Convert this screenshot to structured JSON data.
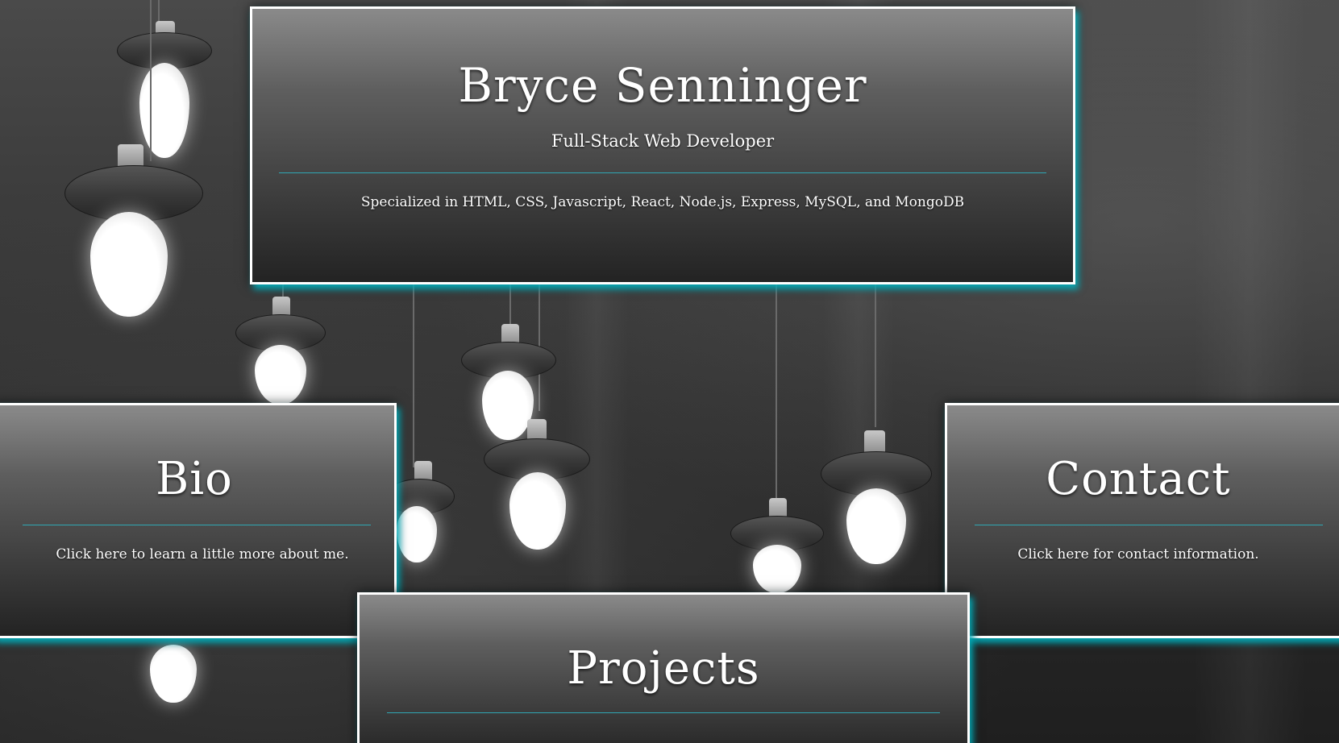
{
  "header": {
    "name": "Bryce Senninger",
    "subtitle": "Full-Stack Web Developer",
    "skills": "Specialized in HTML, CSS, Javascript, React, Node.js, Express, MySQL, and MongoDB"
  },
  "cards": {
    "bio": {
      "title": "Bio",
      "description": "Click here to learn a little more about me."
    },
    "contact": {
      "title": "Contact",
      "description": "Click here for contact information."
    },
    "projects": {
      "title": "Projects"
    }
  },
  "colors": {
    "accent": "#2fa7b4",
    "card_border": "#ffffff",
    "card_glow": "#00bec d"
  }
}
